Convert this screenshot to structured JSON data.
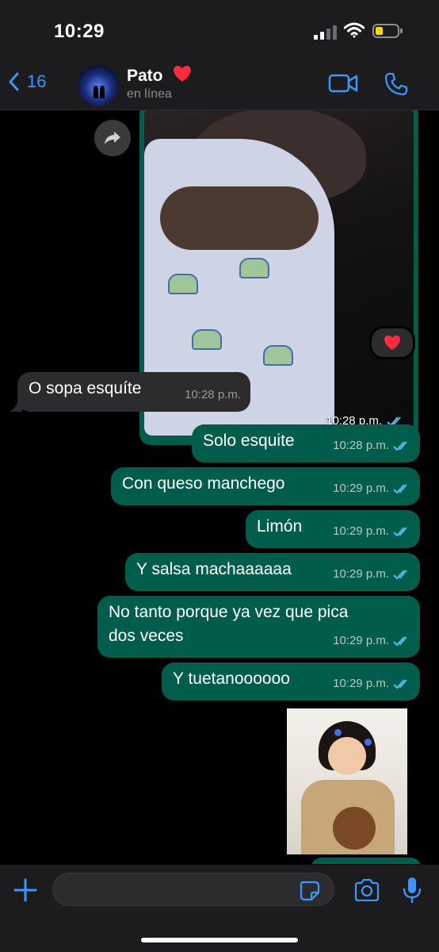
{
  "status_bar": {
    "time": "10:29"
  },
  "header": {
    "back_count": "16",
    "contact_name": "Pato",
    "contact_status": "en línea",
    "icons": [
      "chevron-left-icon",
      "video-camera-icon",
      "phone-icon",
      "heart-icon"
    ],
    "accent_color": "#3e95ff"
  },
  "chat": {
    "photo_message": {
      "time": "10:28 p.m.",
      "reaction": "❤️"
    },
    "messages": [
      {
        "text": "O sopa esquíte",
        "time": "10:28 p.m.",
        "direction": "incoming"
      },
      {
        "text": "Solo esquite",
        "time": "10:28 p.m.",
        "direction": "outgoing"
      },
      {
        "text": "Con queso manchego",
        "time": "10:29 p.m.",
        "direction": "outgoing"
      },
      {
        "text": "Limón",
        "time": "10:29 p.m.",
        "direction": "outgoing"
      },
      {
        "text": "Y salsa machaaaaaa",
        "time": "10:29 p.m.",
        "direction": "outgoing"
      },
      {
        "text": "No tanto porque ya vez que pica dos veces",
        "time": "10:29 p.m.",
        "direction": "outgoing"
      },
      {
        "text": "Y tuetanoooooo",
        "time": "10:29 p.m.",
        "direction": "outgoing"
      }
    ],
    "colors": {
      "outgoing_bubble": "#005c4b",
      "incoming_bubble": "#2c2c2e",
      "read_ticks": "#53bdeb"
    }
  },
  "composer": {
    "input_value": "",
    "icons": [
      "plus-icon",
      "sticker-icon",
      "camera-icon",
      "microphone-icon"
    ]
  }
}
